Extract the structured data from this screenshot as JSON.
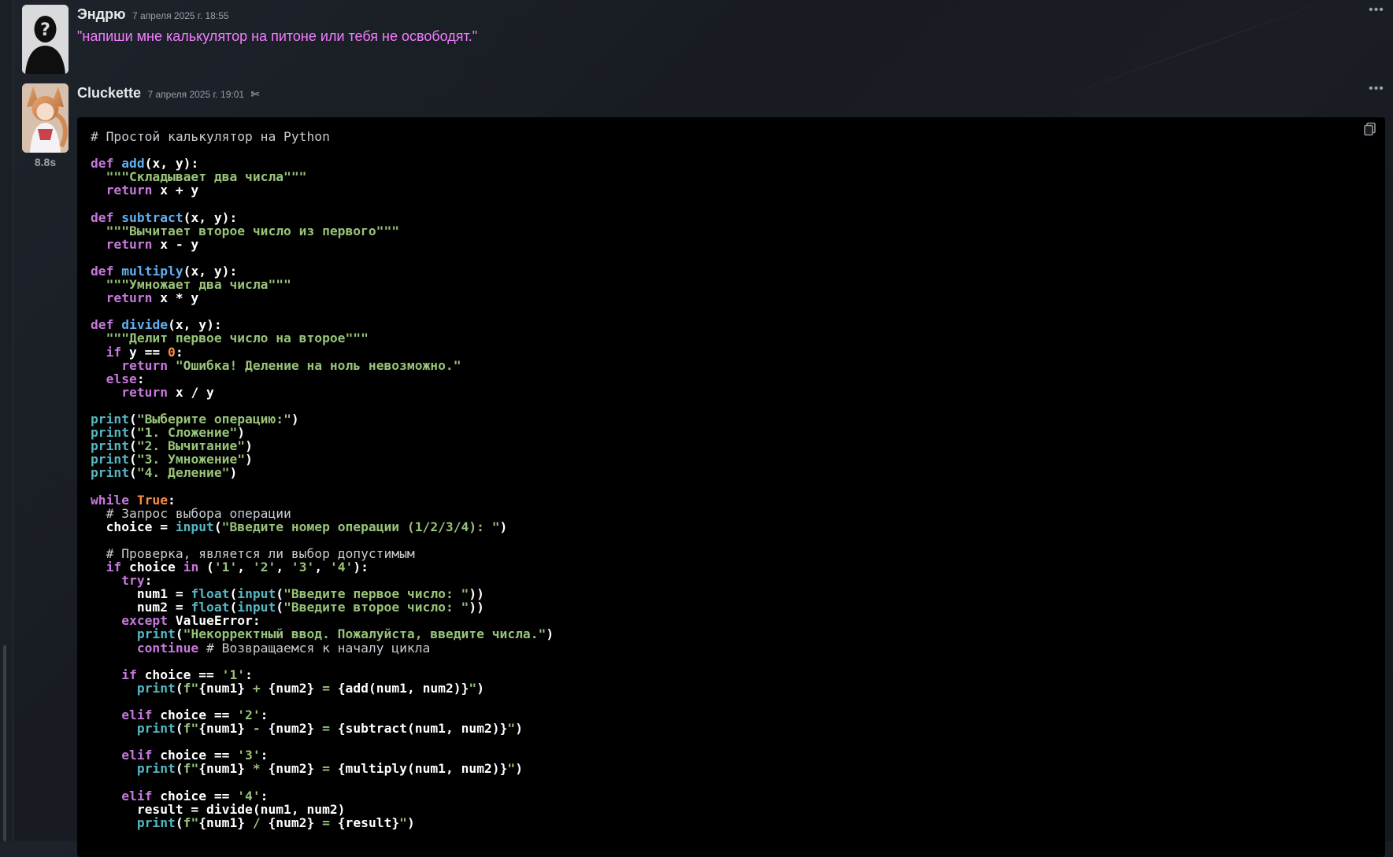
{
  "messages": [
    {
      "author": "Эндрю",
      "timestamp": "7 апреля 2025 г. 18:55",
      "text": "\"напиши мне калькулятор на питоне или тебя не освободят.\""
    },
    {
      "author": "Cluckette",
      "timestamp": "7 апреля 2025 г. 19:01",
      "elapsed": "8.8s"
    }
  ],
  "icons": {
    "more": "more-options-icon",
    "copy": "copy-icon",
    "edited": "sparkle-icon",
    "avatar_default": "default-user-silhouette"
  },
  "code": {
    "l01": "# Простой калькулятор на Python",
    "l02a": "def",
    "l02b": "add",
    "l02c": "(x, y):",
    "l03": "  \"\"\"Складывает два числа\"\"\"",
    "l04a": "  return",
    "l04b": " x + y",
    "l05a": "def",
    "l05b": "subtract",
    "l05c": "(x, y):",
    "l06": "  \"\"\"Вычитает второе число из первого\"\"\"",
    "l07a": "  return",
    "l07b": " x - y",
    "l08a": "def",
    "l08b": "multiply",
    "l08c": "(x, y):",
    "l09": "  \"\"\"Умножает два числа\"\"\"",
    "l10a": "  return",
    "l10b": " x * y",
    "l11a": "def",
    "l11b": "divide",
    "l11c": "(x, y):",
    "l12": "  \"\"\"Делит первое число на второе\"\"\"",
    "l13a": "  if",
    "l13b": " y == ",
    "l13c": "0",
    "l13d": ":",
    "l14a": "    return",
    "l14b": " \"Ошибка! Деление на ноль невозможно.\"",
    "l15a": "  else",
    "l15b": ":",
    "l16a": "    return",
    "l16b": " x / y",
    "l17a": "print",
    "l17b": "(",
    "l17c": "\"Выберите операцию:\"",
    "l17d": ")",
    "l18a": "print",
    "l18b": "(",
    "l18c": "\"1. Сложение\"",
    "l18d": ")",
    "l19a": "print",
    "l19b": "(",
    "l19c": "\"2. Вычитание\"",
    "l19d": ")",
    "l20a": "print",
    "l20b": "(",
    "l20c": "\"3. Умножение\"",
    "l20d": ")",
    "l21a": "print",
    "l21b": "(",
    "l21c": "\"4. Деление\"",
    "l21d": ")",
    "l22a": "while",
    "l22b": " True",
    "l22c": ":",
    "l23": "  # Запрос выбора операции",
    "l24a": "  choice = ",
    "l24b": "input",
    "l24c": "(",
    "l24d": "\"Введите номер операции (1/2/3/4): \"",
    "l24e": ")",
    "l25": "  # Проверка, является ли выбор допустимым",
    "l26a": "  if",
    "l26b": " choice ",
    "l26c": "in",
    "l26d": " (",
    "l26e": "'1'",
    "l26f": ", ",
    "l26g": "'2'",
    "l26h": ", ",
    "l26i": "'3'",
    "l26j": ", ",
    "l26k": "'4'",
    "l26l": "):",
    "l27a": "    try",
    "l27b": ":",
    "l28a": "      num1 = ",
    "l28b": "float",
    "l28c": "(",
    "l28d": "input",
    "l28e": "(",
    "l28f": "\"Введите первое число: \"",
    "l28g": "))",
    "l29a": "      num2 = ",
    "l29b": "float",
    "l29c": "(",
    "l29d": "input",
    "l29e": "(",
    "l29f": "\"Введите второе число: \"",
    "l29g": "))",
    "l30a": "    except",
    "l30b": " ValueError:",
    "l31a": "      print",
    "l31b": "(",
    "l31c": "\"Некорректный ввод. Пожалуйста, введите числа.\"",
    "l31d": ")",
    "l32a": "      continue",
    "l32b": " # Возвращаемся к началу цикла",
    "l33a": "    if",
    "l33b": " choice == ",
    "l33c": "'1'",
    "l33d": ":",
    "l34a": "      print",
    "l34b": "(",
    "l34c": "f\"",
    "l34d": "{num1}",
    "l34e": " + ",
    "l34f": "{num2}",
    "l34g": " = ",
    "l34h": "{add(num1, num2)}",
    "l34i": "\"",
    "l34j": ")",
    "l35a": "    elif",
    "l35b": " choice == ",
    "l35c": "'2'",
    "l35d": ":",
    "l36a": "      print",
    "l36b": "(",
    "l36c": "f\"",
    "l36d": "{num1}",
    "l36e": " - ",
    "l36f": "{num2}",
    "l36g": " = ",
    "l36h": "{subtract(num1, num2)}",
    "l36i": "\"",
    "l36j": ")",
    "l37a": "    elif",
    "l37b": " choice == ",
    "l37c": "'3'",
    "l37d": ":",
    "l38a": "      print",
    "l38b": "(",
    "l38c": "f\"",
    "l38d": "{num1}",
    "l38e": " * ",
    "l38f": "{num2}",
    "l38g": " = ",
    "l38h": "{multiply(num1, num2)}",
    "l38i": "\"",
    "l38j": ")",
    "l39a": "    elif",
    "l39b": " choice == ",
    "l39c": "'4'",
    "l39d": ":",
    "l40": "      result = divide(num1, num2)",
    "l41a": "      print",
    "l41b": "(",
    "l41c": "f\"",
    "l41d": "{num1}",
    "l41e": " / ",
    "l41f": "{num2}",
    "l41g": " = ",
    "l41h": "{result}",
    "l41i": "\"",
    "l41j": ")"
  }
}
